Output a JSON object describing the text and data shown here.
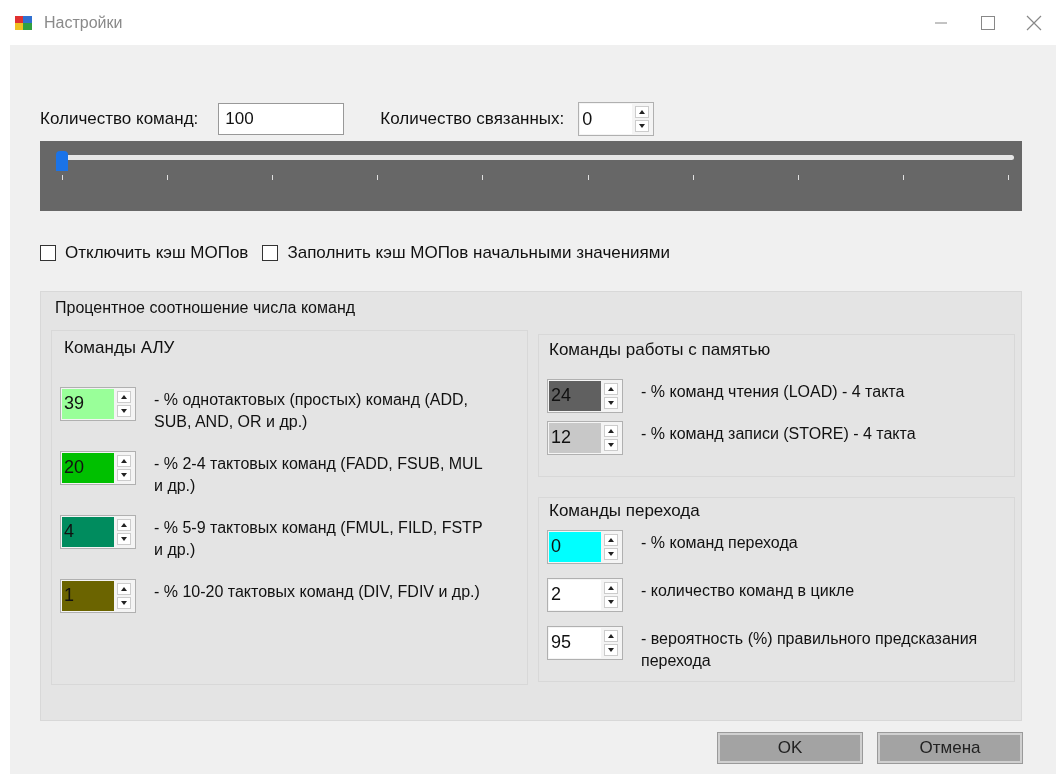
{
  "window": {
    "title": "Настройки"
  },
  "command_count": {
    "label": "Количество команд:",
    "value": "100"
  },
  "linked_count": {
    "label": "Количество связанных:",
    "value": "0"
  },
  "slider": {
    "level": 0
  },
  "checkboxes": [
    {
      "label": "Отключить кэш МОПов",
      "checked": false
    },
    {
      "label": "Заполнить кэш МОПов начальными значениями",
      "checked": false
    }
  ],
  "ratio_group": {
    "title": "Процентное соотношение числа команд",
    "alu": {
      "title": "Команды АЛУ",
      "rows": [
        {
          "value": "39",
          "color": "#99ff99",
          "label": "- % однотактовых (простых) команд (ADD, SUB, AND, OR и др.)"
        },
        {
          "value": "20",
          "color": "#00c000",
          "label": "- % 2-4 тактовых команд (FADD, FSUB, MUL и др.)"
        },
        {
          "value": "4",
          "color": "#008c5e",
          "label": "- % 5-9 тактовых команд (FMUL, FILD, FSTP  и др.)"
        },
        {
          "value": "1",
          "color": "#6b6400",
          "label": "- % 10-20 тактовых команд (DIV, FDIV  и др.)"
        }
      ]
    },
    "memory": {
      "title": "Команды работы с памятью",
      "rows": [
        {
          "value": "24",
          "color": "#606060",
          "label": "- % команд чтения (LOAD) - 4 такта"
        },
        {
          "value": "12",
          "color": "#c8c8c8",
          "label": "- % команд записи (STORE) - 4 такта"
        }
      ]
    },
    "branch": {
      "title": "Команды перехода",
      "rows": [
        {
          "value": "0",
          "color": "#00ffff",
          "label": "- % команд перехода"
        },
        {
          "value": "2",
          "color": "#ffffff",
          "label": "- количество команд в цикле"
        },
        {
          "value": "95",
          "color": "#ffffff",
          "label": "- вероятность (%) правильного предсказания перехода"
        }
      ]
    }
  },
  "buttons": [
    {
      "label": "OK"
    },
    {
      "label": "Отмена"
    }
  ]
}
